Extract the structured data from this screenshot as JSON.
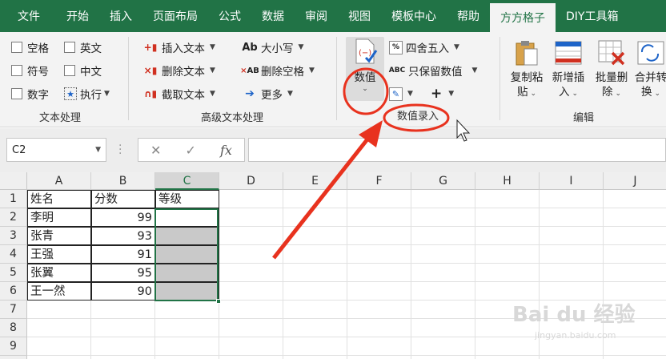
{
  "menu": {
    "tabs": [
      "文件",
      "开始",
      "插入",
      "页面布局",
      "公式",
      "数据",
      "审阅",
      "视图",
      "模板中心",
      "帮助",
      "方方格子",
      "DIY工具箱"
    ],
    "active": "方方格子"
  },
  "ribbon": {
    "text_group": {
      "label": "文本处理",
      "checks": [
        "空格",
        "英文",
        "符号",
        "中文",
        "数字"
      ],
      "execute": "执行"
    },
    "advanced_group": {
      "label": "高级文本处理",
      "insert_text": "插入文本",
      "delete_text": "删除文本",
      "extract_text": "截取文本",
      "case": "大小写",
      "delete_space": "删除空格",
      "more": "更多",
      "case_icon": "Ab",
      "delspace_icon": "AB"
    },
    "number_group": {
      "big_label": "数值",
      "round": "四舍五入",
      "keep_value": "只保留数值",
      "plus": "+",
      "label": "数值录入"
    },
    "edit_group": {
      "label": "编辑",
      "copy_paste": [
        "复制粘",
        "贴"
      ],
      "new_insert": [
        "新增插",
        "入"
      ],
      "batch_delete": [
        "批量删",
        "除"
      ],
      "merge_convert": [
        "合并转",
        "换"
      ]
    }
  },
  "formula_bar": {
    "name_box": "C2",
    "cancel": "✕",
    "confirm": "✓",
    "fx": "fx",
    "value": ""
  },
  "sheet": {
    "columns": [
      "A",
      "B",
      "C",
      "D",
      "E",
      "F",
      "G",
      "H",
      "I",
      "J"
    ],
    "selected_column": "C",
    "rows": [
      "1",
      "2",
      "3",
      "4",
      "5",
      "6",
      "7",
      "8",
      "9",
      "10"
    ],
    "headers": [
      "姓名",
      "分数",
      "等级"
    ],
    "names": [
      "李明",
      "张青",
      "王强",
      "张翼",
      "王一然"
    ],
    "scores": [
      "99",
      "93",
      "91",
      "95",
      "90"
    ]
  },
  "watermark": {
    "brand": "Bai du 经验",
    "url": "jingyan.baidu.com"
  },
  "colors": {
    "accent": "#217346",
    "annotation": "#e8321e",
    "selection_fill": "#c9c9c9"
  }
}
